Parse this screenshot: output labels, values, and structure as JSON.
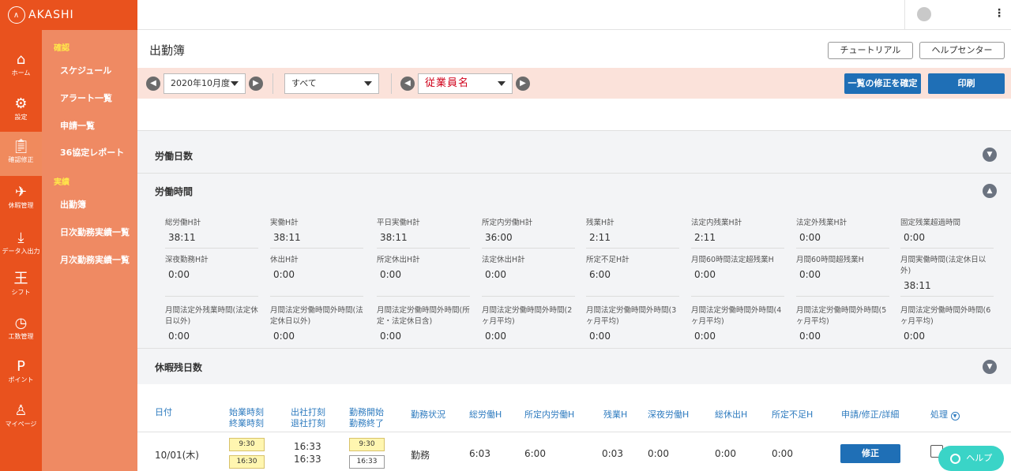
{
  "brand": {
    "name": "AKASHI",
    "icon": "mountain-logo-icon",
    "color": "#e9521e"
  },
  "nav": [
    {
      "label": "ホーム",
      "icon": "home-icon"
    },
    {
      "label": "設定",
      "icon": "gear-icon"
    },
    {
      "label": "確認修正",
      "icon": "clipboard-icon"
    },
    {
      "label": "休暇管理",
      "icon": "plane-icon"
    },
    {
      "label": "データ入出力",
      "icon": "download-icon"
    },
    {
      "label": "シフト",
      "icon": "shift-icon"
    },
    {
      "label": "工数管理",
      "icon": "clock-icon"
    },
    {
      "label": "ポイント",
      "icon": "point-icon"
    },
    {
      "label": "マイページ",
      "icon": "user-icon"
    }
  ],
  "subnav": {
    "group1": "確認",
    "group1_items": [
      "スケジュール",
      "アラート一覧",
      "申請一覧",
      "36協定レポート"
    ],
    "group2": "実績",
    "group2_items": [
      "出勤簿",
      "日次勤務実績一覧",
      "月次勤務実績一覧"
    ]
  },
  "page": {
    "title": "出勤簿",
    "tutorial": "チュートリアル",
    "help_center": "ヘルプセンター"
  },
  "filters": {
    "period": "2020年10月度",
    "scope": "すべて",
    "employee": "従業員名",
    "confirm": "一覧の修正を確定",
    "print": "印刷"
  },
  "sections": {
    "days": "労働日数",
    "hours": "労働時間",
    "leave": "休暇残日数"
  },
  "stats": [
    {
      "label": "総労働H計",
      "value": "38:11"
    },
    {
      "label": "実働H計",
      "value": "38:11"
    },
    {
      "label": "平日実働H計",
      "value": "38:11"
    },
    {
      "label": "所定内労働H計",
      "value": "36:00"
    },
    {
      "label": "残業H計",
      "value": "2:11"
    },
    {
      "label": "法定内残業H計",
      "value": "2:11"
    },
    {
      "label": "法定外残業H計",
      "value": "0:00"
    },
    {
      "label": "固定残業超過時間",
      "value": "0:00"
    },
    {
      "label": "深夜勤務H計",
      "value": "0:00"
    },
    {
      "label": "休出H計",
      "value": "0:00"
    },
    {
      "label": "所定休出H計",
      "value": "0:00"
    },
    {
      "label": "法定休出H計",
      "value": "0:00"
    },
    {
      "label": "所定不足H計",
      "value": "6:00"
    },
    {
      "label": "月間60時間法定超残業H",
      "value": "0:00"
    },
    {
      "label": "月間60時間超残業H",
      "value": "0:00"
    },
    {
      "label": "月間実働時間(法定休日以外)",
      "value": "38:11"
    },
    {
      "label": "月間法定外残業時間(法定休日以外)",
      "value": "0:00"
    },
    {
      "label": "月間法定労働時間外時間(法定休日以外)",
      "value": "0:00"
    },
    {
      "label": "月間法定労働時間外時間(所定・法定休日含)",
      "value": "0:00"
    },
    {
      "label": "月間法定労働時間外時間(2ヶ月平均)",
      "value": "0:00"
    },
    {
      "label": "月間法定労働時間外時間(3ヶ月平均)",
      "value": "0:00"
    },
    {
      "label": "月間法定労働時間外時間(4ヶ月平均)",
      "value": "0:00"
    },
    {
      "label": "月間法定労働時間外時間(5ヶ月平均)",
      "value": "0:00"
    },
    {
      "label": "月間法定労働時間外時間(6ヶ月平均)",
      "value": "0:00"
    }
  ],
  "table": {
    "headers": {
      "date": "日付",
      "start_end": [
        "始業時刻",
        "終業時刻"
      ],
      "clock": [
        "出社打刻",
        "退社打刻"
      ],
      "work": [
        "勤務開始",
        "勤務終了"
      ],
      "status": "勤務状況",
      "total": "総労働H",
      "scheduled": "所定内労働H",
      "overtime": "残業H",
      "night": "深夜労働H",
      "holiday": "総休出H",
      "shortage": "所定不足H",
      "request": "申請/修正/詳細",
      "process": "処理"
    },
    "rows": [
      {
        "date": "10/01(木)",
        "start": "9:30",
        "end": "16:30",
        "clock_in": "16:33",
        "clock_out": "16:33",
        "work_start": "9:30",
        "work_end": "16:33",
        "status": "勤務",
        "total": "6:03",
        "scheduled": "6:00",
        "overtime": "0:03",
        "night": "0:00",
        "holiday": "0:00",
        "shortage": "0:00",
        "action": "修正"
      }
    ]
  },
  "help_button": "ヘルプ"
}
